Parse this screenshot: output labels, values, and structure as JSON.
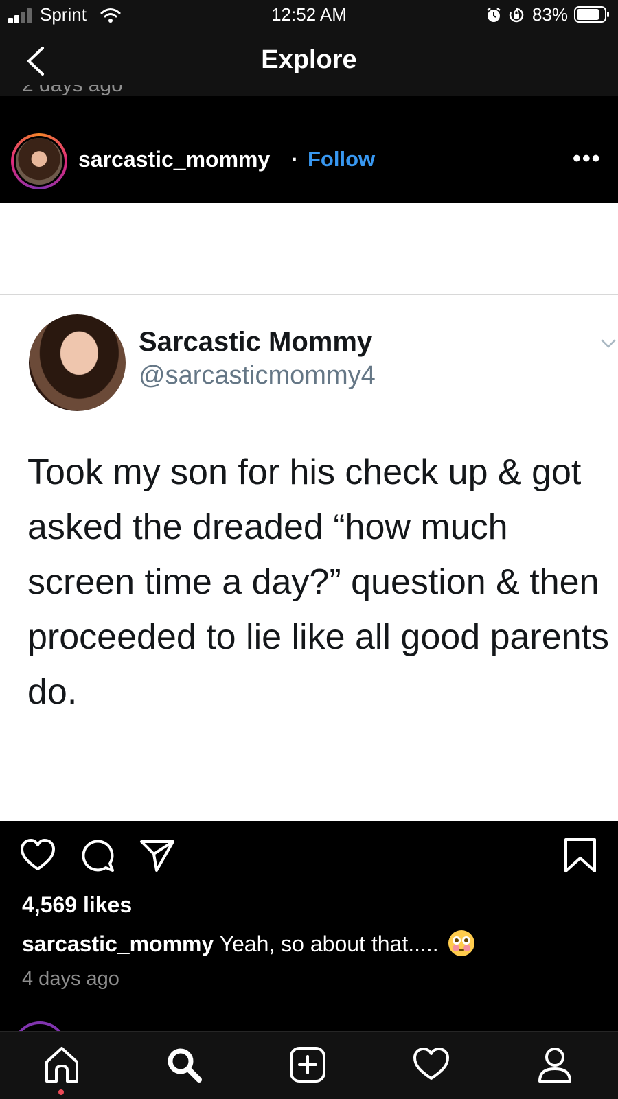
{
  "status_bar": {
    "carrier": "Sprint",
    "time": "12:52 AM",
    "battery_percent": "83%",
    "battery_level": 0.83,
    "icons": [
      "signal-icon",
      "wifi-icon",
      "alarm-icon",
      "rotation-lock-icon",
      "battery-icon"
    ]
  },
  "header": {
    "title": "Explore",
    "back_icon": "chevron-left-icon",
    "previous_post_time": "2 days ago"
  },
  "post": {
    "username": "sarcastic_mommy",
    "separator": "·",
    "follow_label": "Follow",
    "more_label": "•••",
    "tweet": {
      "display_name": "Sarcastic Mommy",
      "handle": "@sarcasticmommy4",
      "text": "Took my son for his check up & got asked the dreaded “how much screen time a day?” question & then proceeded to lie like all good parents do."
    },
    "likes": "4,569 likes",
    "caption_user": "sarcastic_mommy",
    "caption_text": "Yeah, so about that.....",
    "caption_emoji": "flushed-face-emoji",
    "posted": "4 days ago",
    "action_icons": [
      "heart-icon",
      "comment-icon",
      "share-icon",
      "bookmark-icon"
    ]
  },
  "tab_bar": {
    "items": [
      "home-icon",
      "search-icon",
      "add-post-icon",
      "activity-heart-icon",
      "profile-icon"
    ],
    "active": "home-icon"
  },
  "colors": {
    "background": "#000000",
    "bar": "#121212",
    "link_blue": "#3897f0",
    "tweet_text": "#14171a",
    "tweet_handle": "#657786",
    "muted": "#8e8e8e",
    "notification_dot": "#ed4956"
  }
}
